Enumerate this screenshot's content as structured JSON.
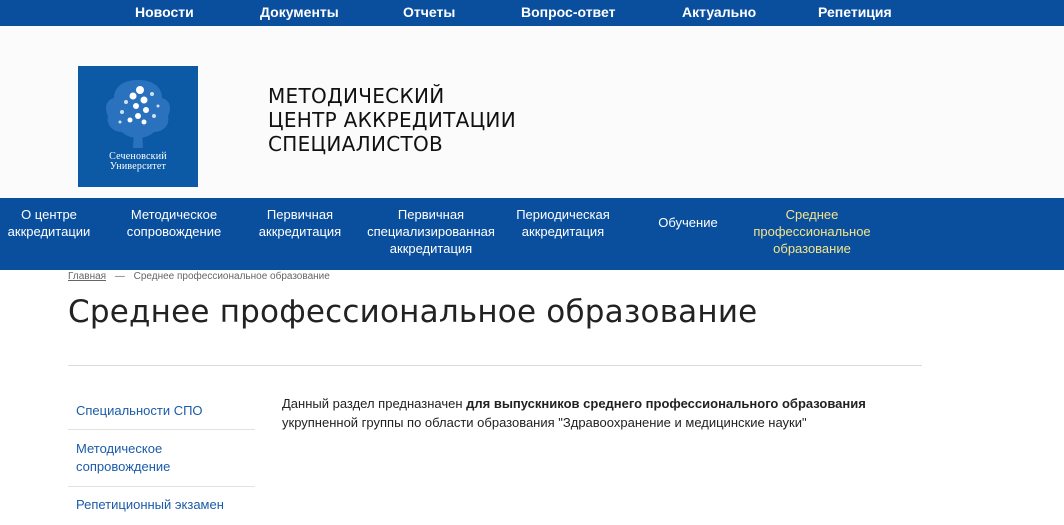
{
  "top_nav": [
    "Новости",
    "Документы",
    "Отчеты",
    "Вопрос-ответ",
    "Актуально",
    "Репетиция"
  ],
  "logo": {
    "line1": "Сеченовский",
    "line2": "Университет",
    "bg_color": "#0c5aa6"
  },
  "site_title": {
    "line1": "МЕТОДИЧЕСКИЙ",
    "line2": "ЦЕНТР АККРЕДИТАЦИИ",
    "line3": "СПЕЦИАЛИСТОВ"
  },
  "main_nav": [
    {
      "line1": "О центре",
      "line2": "аккредитации",
      "line3": ""
    },
    {
      "line1": "Методическое",
      "line2": "сопровождение",
      "line3": ""
    },
    {
      "line1": "Первичная",
      "line2": "аккредитация",
      "line3": ""
    },
    {
      "line1": "Первичная",
      "line2": "специализированная",
      "line3": "аккредитация"
    },
    {
      "line1": "Периодическая",
      "line2": "аккредитация",
      "line3": ""
    },
    {
      "line1": "Обучение",
      "line2": "",
      "line3": ""
    },
    {
      "line1": "Среднее",
      "line2": "профессиональное",
      "line3": "образование"
    }
  ],
  "breadcrumb": {
    "home": "Главная",
    "separator": "—",
    "current": "Среднее профессиональное образование"
  },
  "page_title": "Среднее профессиональное образование",
  "sidebar": [
    "Специальности СПО",
    "Методическое сопровождение",
    "Репетиционный экзамен"
  ],
  "intro": {
    "prefix": "Данный раздел предназначен ",
    "bold": "для выпускников среднего профессионального образования",
    "suffix": " укрупненной группы по области образования \"Здравоохранение и медицинские науки\""
  },
  "colors": {
    "nav_bg": "#0a4f9e",
    "active_nav": "#f3e58b",
    "link": "#1b5ba8"
  }
}
